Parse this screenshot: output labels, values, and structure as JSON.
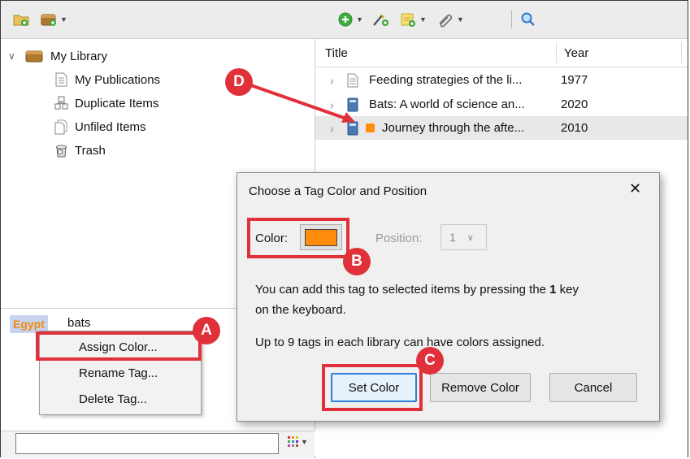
{
  "toolbar": {
    "icons": [
      "new-collection-icon",
      "new-library-icon",
      "new-item-icon",
      "add-by-identifier-icon",
      "new-note-icon",
      "add-attachment-icon",
      "search-icon"
    ]
  },
  "library": {
    "root": "My Library",
    "items": [
      {
        "label": "My Publications",
        "icon": "document-icon"
      },
      {
        "label": "Duplicate Items",
        "icon": "duplicate-icon"
      },
      {
        "label": "Unfiled Items",
        "icon": "unfiled-icon"
      },
      {
        "label": "Trash",
        "icon": "trash-icon"
      }
    ]
  },
  "tags": {
    "egypt": "Egypt",
    "bats": "bats"
  },
  "context_menu": {
    "items": [
      "Assign Color...",
      "Rename Tag...",
      "Delete Tag..."
    ]
  },
  "items_table": {
    "columns": [
      "Title",
      "Year"
    ],
    "rows": [
      {
        "title": "Feeding strategies of the li...",
        "year": "1977",
        "tag_color": ""
      },
      {
        "title": "Bats: A world of science an...",
        "year": "2020",
        "tag_color": ""
      },
      {
        "title": "Journey through the afte...",
        "year": "2010",
        "tag_color": "#ff8c0a"
      }
    ]
  },
  "dialog": {
    "title": "Choose a Tag Color and Position",
    "close": "✕",
    "color_label": "Color:",
    "selected_color": "#ff8c0a",
    "position_label": "Position:",
    "position_value": "1",
    "info_line1_a": "You can add this tag to selected items by pressing the ",
    "info_key": "1",
    "info_line1_b": " key",
    "info_line2": "on the keyboard.",
    "info_line3": "Up to 9 tags in each library can have colors assigned.",
    "buttons": {
      "set": "Set Color",
      "remove": "Remove Color",
      "cancel": "Cancel"
    }
  },
  "annotations": {
    "accent": "#e0303a",
    "a": "A",
    "b": "B",
    "c": "C",
    "d": "D"
  }
}
